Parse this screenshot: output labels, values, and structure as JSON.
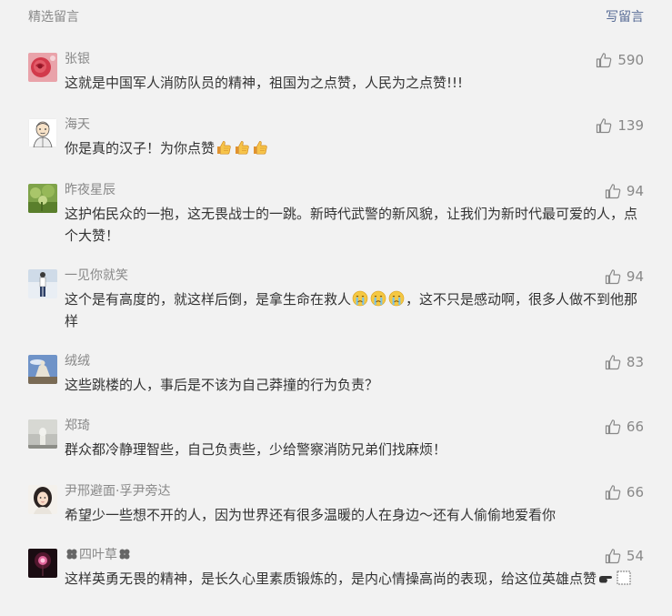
{
  "header": {
    "title": "精选留言",
    "write_label": "写留言"
  },
  "colors": {
    "background": "#f2f2f2",
    "name": "#888888",
    "text": "#333333",
    "link": "#576b95"
  },
  "comments": [
    {
      "name": "张银",
      "likes": "590",
      "text": "这就是中国军人消防队员的精神，祖国为之点赞，人民为之点赞!!!",
      "avatar_icon": "red-rose-avatar"
    },
    {
      "name": "海天",
      "likes": "139",
      "text_before_emoji": "你是真的汉子！为你点赞",
      "emoji": [
        "thumbs-up-icon",
        "thumbs-up-icon",
        "thumbs-up-icon"
      ],
      "avatar_icon": "cartoon-man-avatar"
    },
    {
      "name": "昨夜星辰",
      "likes": "94",
      "text": "这护佑民众的一抱，这无畏战士的一跳。新時代武警的新风貌，让我们为新时代最可爱的人，点个大赞！",
      "avatar_icon": "green-plant-avatar"
    },
    {
      "name": "一见你就笑",
      "likes": "94",
      "text_before_emoji": "这个是有高度的，就这样后倒，是拿生命在救人",
      "emoji": [
        "crying-face-icon",
        "crying-face-icon",
        "crying-face-icon"
      ],
      "text_after_emoji": "，这不只是感动啊，很多人做不到他那样",
      "avatar_icon": "standing-woman-avatar"
    },
    {
      "name": "绒绒",
      "likes": "83",
      "text": "这些跳楼的人，事后是不该为自己莽撞的行为负责？",
      "avatar_icon": "statue-sky-avatar"
    },
    {
      "name": "郑琦",
      "likes": "66",
      "text": "群众都冷静理智些，自己负责些，少给警察消防兄弟们找麻烦！",
      "avatar_icon": "grey-figurine-avatar"
    },
    {
      "name": "尹邢避面·孚尹旁达",
      "likes": "66",
      "text": "希望少一些想不开的人，因为世界还有很多温暖的人在身边～还有人偷偷地爱看你",
      "avatar_icon": "girl-portrait-avatar"
    },
    {
      "name_prefix_icon": "clover-icon",
      "name": "四叶草",
      "name_suffix_icon": "clover-icon",
      "likes": "54",
      "text_before_emoji": "这样英勇无畏的精神，是长久心里素质锻炼的，是内心情操高尚的表现，给这位英雄点赞",
      "emoji": [
        "pointing-hand-icon",
        "placeholder-box-icon"
      ],
      "avatar_icon": "pink-light-avatar"
    }
  ]
}
